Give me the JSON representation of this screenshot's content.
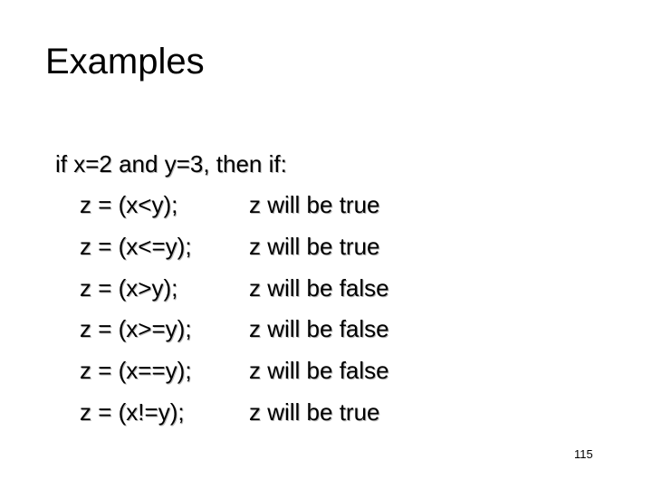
{
  "slide": {
    "title": "Examples",
    "intro": "if x=2 and y=3, then if:",
    "rows": [
      {
        "expr": "z = (x<y);",
        "result": "z will be true"
      },
      {
        "expr": "z = (x<=y);",
        "result": "z will be true"
      },
      {
        "expr": "z = (x>y);",
        "result": "z will be false"
      },
      {
        "expr": "z = (x>=y);",
        "result": "z will be false"
      },
      {
        "expr": "z = (x==y);",
        "result": "z will be false"
      },
      {
        "expr": "z = (x!=y);",
        "result": "z will be true"
      }
    ],
    "page_number": "115"
  }
}
